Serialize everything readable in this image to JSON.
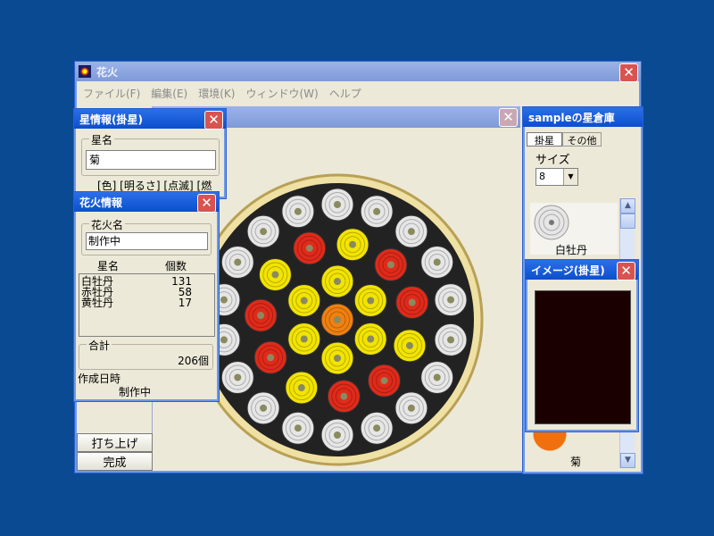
{
  "main": {
    "title": "花火",
    "menu": [
      "ファイル(F)",
      "編集(E)",
      "環境(K)",
      "ウィンドウ(W)",
      "ヘルプ"
    ],
    "bottom_buttons": {
      "launch": "打ち上げ",
      "complete": "完成"
    }
  },
  "star_info": {
    "title": "星情報(掛星)",
    "star_name_label": "星名",
    "star_name_value": "菊",
    "options": "[色] [明るさ] [点滅] [燃焼]"
  },
  "fw_info": {
    "title": "花火情報",
    "name_label": "花火名",
    "name_value": "制作中",
    "col_star": "星名",
    "col_count": "個数",
    "rows": [
      {
        "name": "白牡丹",
        "count": "131"
      },
      {
        "name": "赤牡丹",
        "count": "58"
      },
      {
        "name": "黄牡丹",
        "count": "17"
      }
    ],
    "total_label": "合計",
    "total_value": "206個",
    "date_label": "作成日時",
    "date_value": "制作中"
  },
  "warehouse": {
    "title": "sampleの星倉庫",
    "tabs": [
      "掛星",
      "その他"
    ],
    "size_label": "サイズ",
    "size_value": "8",
    "item1": "白牡丹",
    "item2": "菊"
  },
  "image_win": {
    "title": "イメージ(掛星)",
    "color": "#1b0000"
  },
  "colors": {
    "desktop": "#0a4a93",
    "red": "#e02a1a",
    "yellow": "#f2e400",
    "white": "#e6e6e6",
    "orange": "#f08010"
  }
}
